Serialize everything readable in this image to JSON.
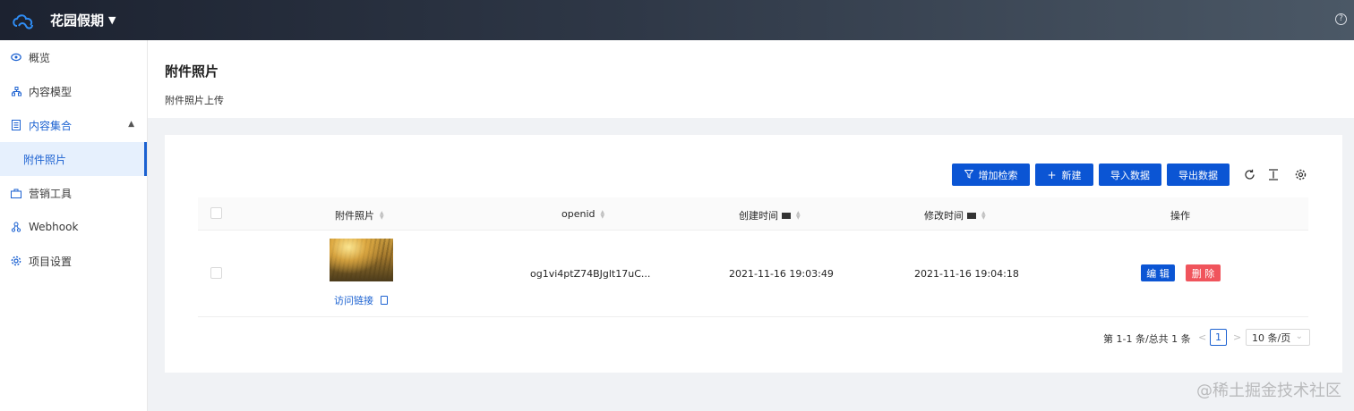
{
  "app": {
    "title": "花园假期",
    "help_icon": "?"
  },
  "sidebar": {
    "items": [
      {
        "label": "概览",
        "icon": "eye-icon"
      },
      {
        "label": "内容模型",
        "icon": "model-icon"
      },
      {
        "label": "内容集合",
        "icon": "collection-icon"
      },
      {
        "label": "附件照片",
        "icon": ""
      },
      {
        "label": "营销工具",
        "icon": "briefcase-icon"
      },
      {
        "label": "Webhook",
        "icon": "webhook-icon"
      },
      {
        "label": "项目设置",
        "icon": "gear-icon"
      }
    ]
  },
  "header": {
    "title": "附件照片",
    "subtitle": "附件照片上传"
  },
  "toolbar": {
    "filter": "增加检索",
    "create": "新建",
    "import": "导入数据",
    "export": "导出数据"
  },
  "table": {
    "columns": [
      "附件照片",
      "openid",
      "创建时间",
      "修改时间",
      "操作"
    ],
    "rows": [
      {
        "link": "访问链接",
        "openid": "og1vi4ptZ74BJglt17uC...",
        "created": "2021-11-16 19:03:49",
        "modified": "2021-11-16 19:04:18",
        "edit": "编 辑",
        "delete": "删 除"
      }
    ]
  },
  "pagination": {
    "info": "第 1-1 条/总共 1 条",
    "current": "1",
    "prev": "<",
    "next": ">",
    "page_size": "10 条/页"
  },
  "watermark": "@稀土掘金技术社区",
  "colors": {
    "primary": "#0b55d4",
    "danger": "#f0545c",
    "link": "#1b61d1"
  }
}
